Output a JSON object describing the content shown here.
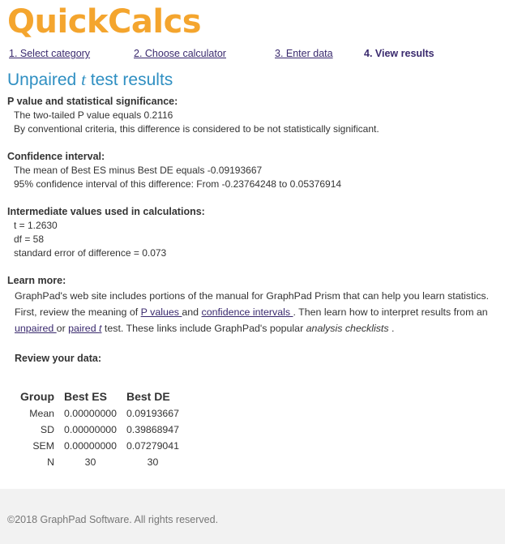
{
  "app": {
    "logo_text": "QuickCalcs"
  },
  "steps": [
    {
      "label": "1. Select category"
    },
    {
      "label": "2. Choose calculator"
    },
    {
      "label": "3. Enter data"
    },
    {
      "label": "4. View results"
    }
  ],
  "page": {
    "title_pre": "Unpaired ",
    "title_t": "t",
    "title_post": " test results"
  },
  "pvalue": {
    "heading": "P value and statistical significance:",
    "line1": "The two-tailed P value equals 0.2116",
    "line2": "By conventional criteria, this difference is considered to be not statistically significant."
  },
  "ci": {
    "heading": "Confidence interval:",
    "line1": "The mean of Best ES minus Best DE equals -0.09193667",
    "line2": "95% confidence interval of this difference: From -0.23764248 to 0.05376914"
  },
  "intermediate": {
    "heading": "Intermediate values used in calculations:",
    "t": "t = 1.2630",
    "df": "df = 58",
    "se": "standard error of difference = 0.073"
  },
  "learn": {
    "heading": "Learn more:",
    "text1": "GraphPad's web site includes portions of the manual for GraphPad Prism that can help you learn statistics. First, review the meaning of ",
    "link_pvalues": "P values ",
    "text2": "and ",
    "link_ci": "confidence intervals ",
    "text3": ". Then learn how to interpret results from an ",
    "link_unpaired": "unpaired ",
    "text4": "or ",
    "link_paired_pre": "paired ",
    "link_paired_t": "t",
    "text5": " test. These links include GraphPad's popular ",
    "checklists": "analysis checklists",
    "text6": " ."
  },
  "review": {
    "heading": "Review your data:",
    "columns": [
      "Group",
      "Best ES",
      "Best DE"
    ],
    "rows": [
      {
        "label": "Mean",
        "es": "0.00000000",
        "de": "0.09193667"
      },
      {
        "label": "SD",
        "es": "0.00000000",
        "de": "0.39868947"
      },
      {
        "label": "SEM",
        "es": "0.00000000",
        "de": "0.07279041"
      },
      {
        "label": "N",
        "es": "30",
        "de": "30"
      }
    ]
  },
  "footer": {
    "text": "©2018 GraphPad Software. All rights reserved."
  },
  "colors": {
    "logo": "#f4a52e",
    "title": "#2f8fc2",
    "link": "#3a2a6e",
    "footer_bg": "#f2f2f2"
  }
}
